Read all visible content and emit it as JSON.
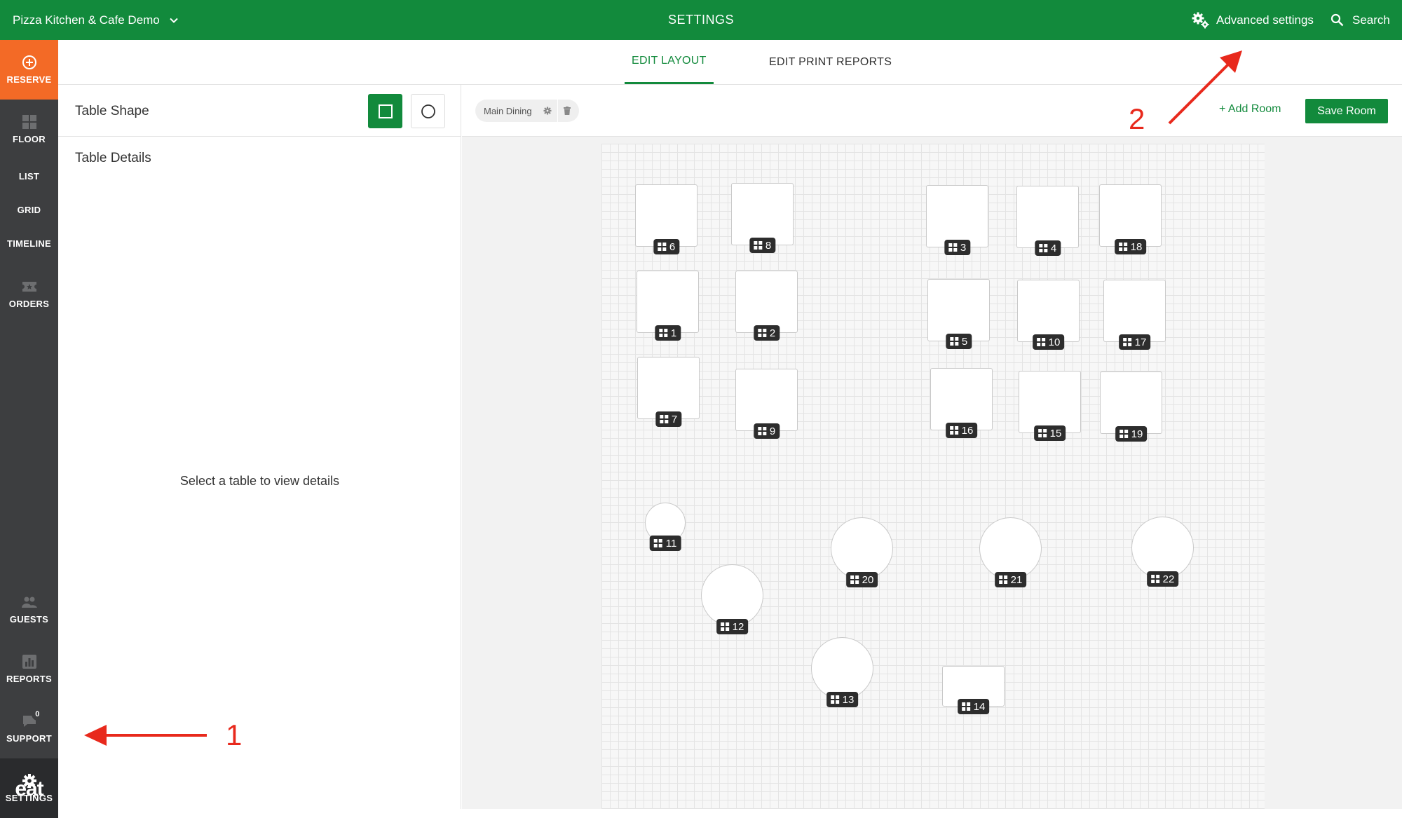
{
  "header": {
    "venue": "Pizza Kitchen & Cafe Demo",
    "title": "SETTINGS",
    "advanced_settings": "Advanced settings",
    "search": "Search"
  },
  "sidebar": {
    "items": [
      {
        "label": "RESERVE",
        "icon": "plus-circle-icon"
      },
      {
        "label": "FLOOR",
        "icon": "grid-icon"
      },
      {
        "label": "LIST"
      },
      {
        "label": "GRID"
      },
      {
        "label": "TIMELINE"
      },
      {
        "label": "ORDERS",
        "icon": "ticket-icon"
      },
      {
        "label": "GUESTS",
        "icon": "people-icon"
      },
      {
        "label": "REPORTS",
        "icon": "chart-icon"
      },
      {
        "label": "SUPPORT",
        "icon": "chat-icon",
        "badge": "0"
      },
      {
        "label": "SETTINGS",
        "icon": "gear-icon"
      }
    ],
    "logo": "eat"
  },
  "tabs": {
    "edit_layout": "EDIT LAYOUT",
    "edit_print_reports": "EDIT PRINT REPORTS"
  },
  "left_panel": {
    "table_shape_title": "Table Shape",
    "table_details_title": "Table Details",
    "empty_message": "Select a table to view details"
  },
  "room_bar": {
    "room_name": "Main Dining",
    "add_room": "+ Add Room",
    "save_room": "Save Room"
  },
  "tables": {
    "t1": "1",
    "t2": "2",
    "t3": "3",
    "t4": "4",
    "t5": "5",
    "t6": "6",
    "t7": "7",
    "t8": "8",
    "t9": "9",
    "t10": "10",
    "t11": "11",
    "t12": "12",
    "t13": "13",
    "t14": "14",
    "t15": "15",
    "t16": "16",
    "t17": "17",
    "t18": "18",
    "t19": "19",
    "t20": "20",
    "t21": "21",
    "t22": "22"
  },
  "annotations": {
    "marker_1": "1",
    "marker_2": "2"
  },
  "colors": {
    "brand_green": "#128a3c",
    "reserve_orange": "#f36a26",
    "sidebar_dark": "#3d3e40",
    "annotation_red": "#e8291c"
  }
}
